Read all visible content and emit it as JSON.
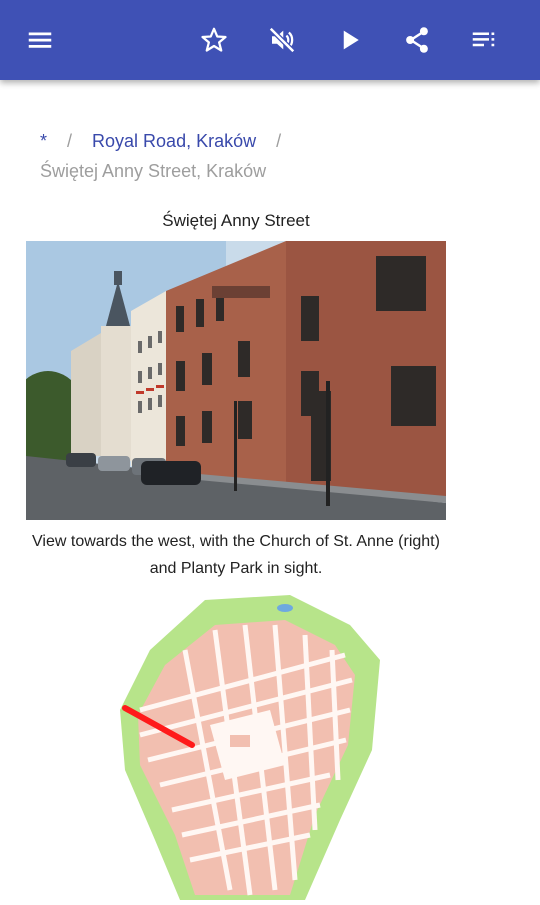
{
  "toolbar": {
    "menu_icon": "menu-icon",
    "star_icon": "star-outline-icon",
    "mute_icon": "volume-off-icon",
    "play_icon": "play-icon",
    "share_icon": "share-icon",
    "list_icon": "playlist-icon",
    "accent": "#3f51b5"
  },
  "breadcrumb": {
    "home": "*",
    "separator": "/",
    "parent": "Royal Road, Kraków",
    "current": "Świętej Anny Street, Kraków"
  },
  "figure": {
    "title": "Świętej Anny Street",
    "caption": "View towards the west, with the Church of St. Anne (right) and Planty Park in sight."
  }
}
